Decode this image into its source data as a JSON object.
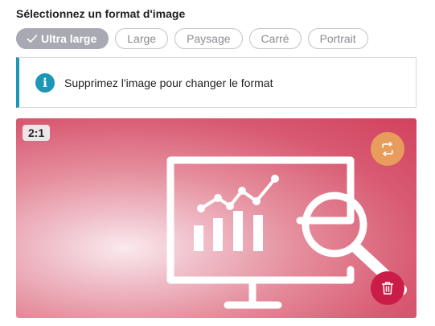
{
  "section_title": "Sélectionnez un format d'image",
  "formats": [
    {
      "label": "Ultra large",
      "selected": true
    },
    {
      "label": "Large",
      "selected": false
    },
    {
      "label": "Paysage",
      "selected": false
    },
    {
      "label": "Carré",
      "selected": false
    },
    {
      "label": "Portrait",
      "selected": false
    }
  ],
  "notice": {
    "icon": "info-icon",
    "message": "Supprimez l'image pour changer le format"
  },
  "image": {
    "ratio_badge": "2:1",
    "swap_icon": "swap-icon",
    "delete_icon": "trash-icon"
  },
  "colors": {
    "accent_info": "#1e97b7",
    "selected_pill": "#a9a9b3",
    "swap_button": "#e99d5c",
    "delete_button": "#c91d47"
  }
}
